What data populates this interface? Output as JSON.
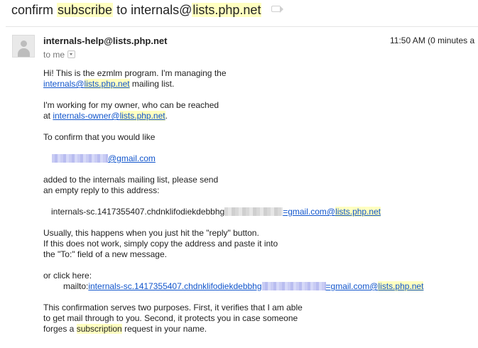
{
  "subject": {
    "prefix": "confirm ",
    "highlight": "subscribe",
    "middle": " to internals@",
    "highlight2": "lists.php.net",
    "label_icon": "label-tag-icon"
  },
  "message": {
    "avatar_icon": "default-avatar-icon",
    "sender": "internals-help@lists.php.net",
    "time": "11:50 AM (0 minutes a",
    "to": "to me",
    "body": {
      "p1_l1": "Hi! This is the ezmlm program. I'm managing the",
      "p1_link_a": "internals@",
      "p1_link_b": "lists.php.net",
      "p1_rest": " mailing list.",
      "p2_l1": "I'm working for my owner, who can be reached",
      "p2_at": "at ",
      "p2_link_a": "internals-owner@",
      "p2_link_b": "lists.php.net",
      "p2_dot": ".",
      "p3": "To confirm that you would like",
      "email_suffix": "@gmail.com",
      "p4_l1": "added to the internals mailing list, please send",
      "p4_l2": "an empty reply to this address:",
      "addr_plain": "internals-sc.1417355407.chdnklifodiekdebbhg",
      "addr_link_a": "=gmail.com@",
      "addr_link_b": "lists.php.net",
      "p5_l1": "Usually, this happens when you just hit the \"reply\" button.",
      "p5_l2": "If this does not work, simply copy the address and paste it into",
      "p5_l3": "the \"To:\" field of a new message.",
      "p6_l1": "or click here:",
      "mailto_label": "mailto:",
      "mailto_link_a": "internals-sc.1417355407.chdnklifodiekdebbhg",
      "mailto_link_b": "=gmail.com@",
      "mailto_link_c": "lists.php.net",
      "p7_l1": "This confirmation serves two purposes. First, it verifies that I am able",
      "p7_l2": "to get mail through to you. Second, it protects you in case someone",
      "p7_l3a": "forges a ",
      "p7_l3_hl": "subscription",
      "p7_l3b": " request in your name."
    }
  },
  "colors": {
    "link": "#1155cc",
    "highlight": "#ffffc0",
    "text": "#222222",
    "muted": "#777777"
  }
}
